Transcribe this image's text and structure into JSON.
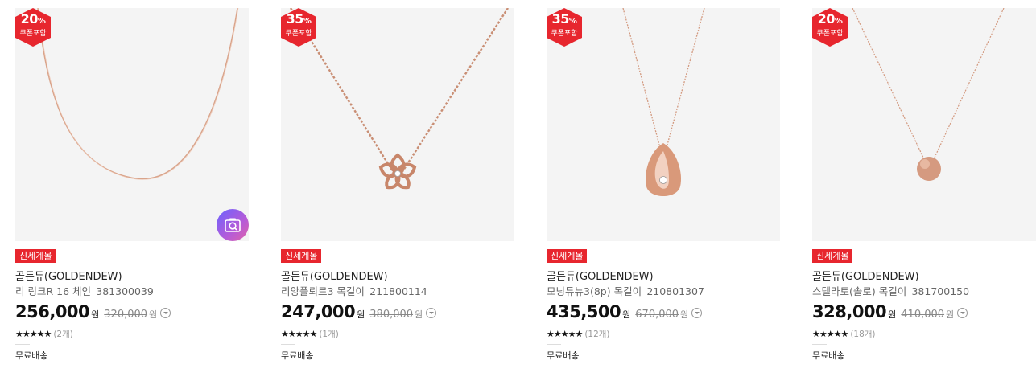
{
  "products": [
    {
      "discount": "20",
      "discount_unit": "%",
      "coupon_label": "쿠폰포함",
      "tag": "신세계몰",
      "brand": "골든듀(GOLDENDEW)",
      "name": "리 링크R 16 체인_381300039",
      "price": "256,000",
      "price_unit": "원",
      "original_price": "320,000",
      "original_unit": "원",
      "stars": "★★★★★",
      "review_count": "(2개)",
      "shipping": "무료배송",
      "has_photo_search": true
    },
    {
      "discount": "35",
      "discount_unit": "%",
      "coupon_label": "쿠폰포함",
      "tag": "신세계몰",
      "brand": "골든듀(GOLDENDEW)",
      "name": "리앙플뢰르3 목걸이_211800114",
      "price": "247,000",
      "price_unit": "원",
      "original_price": "380,000",
      "original_unit": "원",
      "stars": "★★★★★",
      "review_count": "(1개)",
      "shipping": "무료배송"
    },
    {
      "discount": "35",
      "discount_unit": "%",
      "coupon_label": "쿠폰포함",
      "tag": "신세계몰",
      "brand": "골든듀(GOLDENDEW)",
      "name": "모닝듀뉴3(8p) 목걸이_210801307",
      "price": "435,500",
      "price_unit": "원",
      "original_price": "670,000",
      "original_unit": "원",
      "stars": "★★★★★",
      "review_count": "(12개)",
      "shipping": "무료배송"
    },
    {
      "discount": "20",
      "discount_unit": "%",
      "coupon_label": "쿠폰포함",
      "tag": "신세계몰",
      "brand": "골든듀(GOLDENDEW)",
      "name": "스텔라토(솔로) 목걸이_381700150",
      "price": "328,000",
      "price_unit": "원",
      "original_price": "410,000",
      "original_unit": "원",
      "stars": "★★★★★",
      "review_count": "(18개)",
      "shipping": "무료배송"
    }
  ],
  "colors": {
    "badge_red": "#e7262e",
    "tag_red": "#e7262e",
    "image_bg": "#f4f4f4",
    "rose_gold": "#d9a48b"
  },
  "icons": {
    "photo_search": "camera-search-icon",
    "price_info": "chevron-down-circle-icon",
    "rating": "star-icon"
  }
}
